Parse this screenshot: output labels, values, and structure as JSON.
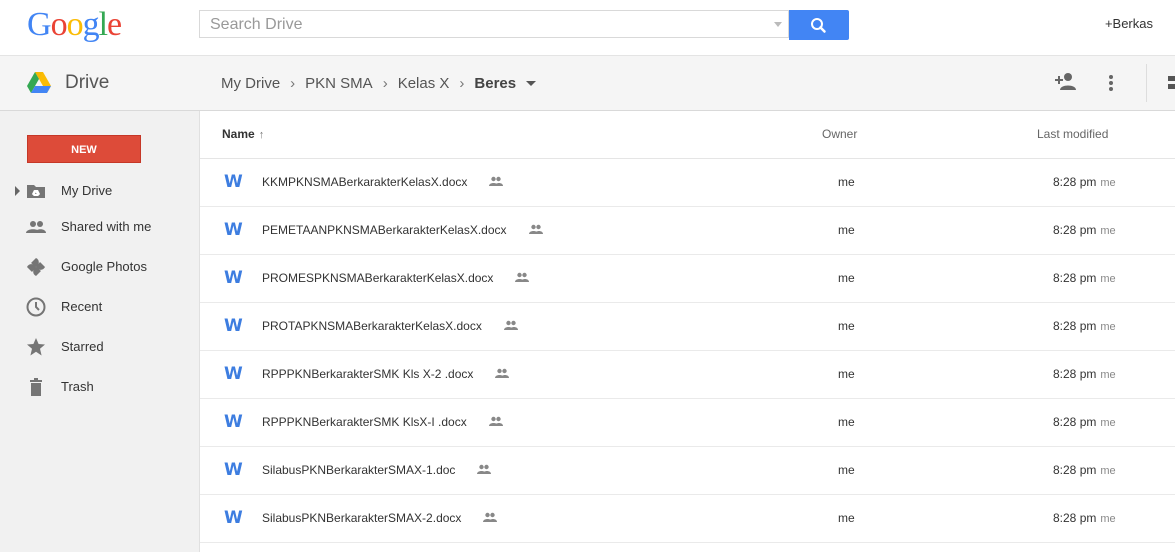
{
  "header": {
    "logo_letters": [
      {
        "ch": "G",
        "color": "#4285f4"
      },
      {
        "ch": "o",
        "color": "#ea4335"
      },
      {
        "ch": "o",
        "color": "#fbbc05"
      },
      {
        "ch": "g",
        "color": "#4285f4"
      },
      {
        "ch": "l",
        "color": "#34a853"
      },
      {
        "ch": "e",
        "color": "#ea4335"
      }
    ],
    "search_placeholder": "Search Drive",
    "user_link": "+Berkas"
  },
  "drivebar": {
    "title": "Drive",
    "breadcrumb": [
      "My Drive",
      "PKN SMA",
      "Kelas X"
    ],
    "current_folder": "Beres"
  },
  "sidebar": {
    "new_label": "NEW",
    "items": [
      {
        "label": "My Drive",
        "icon": "drive-folder-icon"
      },
      {
        "label": "Shared with me",
        "icon": "people-icon"
      },
      {
        "label": "Google Photos",
        "icon": "pinwheel-icon"
      },
      {
        "label": "Recent",
        "icon": "clock-icon"
      },
      {
        "label": "Starred",
        "icon": "star-icon"
      },
      {
        "label": "Trash",
        "icon": "trash-icon"
      }
    ]
  },
  "columns": {
    "name": "Name",
    "sort_arrow": "↑",
    "owner": "Owner",
    "modified": "Last modified"
  },
  "files": [
    {
      "name": "KKMPKNSMABerkarakterKelasX.docx",
      "owner": "me",
      "time": "8:28 pm",
      "by": "me"
    },
    {
      "name": "PEMETAANPKNSMABerkarakterKelasX.docx",
      "owner": "me",
      "time": "8:28 pm",
      "by": "me"
    },
    {
      "name": "PROMESPKNSMABerkarakterKelasX.docx",
      "owner": "me",
      "time": "8:28 pm",
      "by": "me"
    },
    {
      "name": "PROTAPKNSMABerkarakterKelasX.docx",
      "owner": "me",
      "time": "8:28 pm",
      "by": "me"
    },
    {
      "name": "RPPPKNBerkarakterSMK Kls X-2 .docx",
      "owner": "me",
      "time": "8:28 pm",
      "by": "me"
    },
    {
      "name": "RPPPKNBerkarakterSMK KlsX-I .docx",
      "owner": "me",
      "time": "8:28 pm",
      "by": "me"
    },
    {
      "name": "SilabusPKNBerkarakterSMAX-1.doc",
      "owner": "me",
      "time": "8:28 pm",
      "by": "me"
    },
    {
      "name": "SilabusPKNBerkarakterSMAX-2.docx",
      "owner": "me",
      "time": "8:28 pm",
      "by": "me"
    }
  ],
  "colors": {
    "accent": "#4285f4",
    "new_button": "#dd4b39",
    "word_icon": "#3d7de0"
  }
}
